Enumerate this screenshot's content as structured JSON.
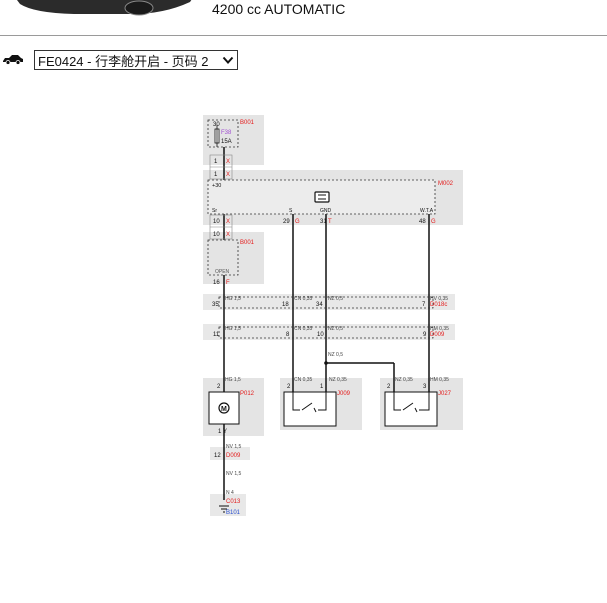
{
  "header": {
    "engine_label": "4200 cc AUTOMATIC",
    "car_icon": "car-side-icon"
  },
  "page_selector": {
    "value": "FE0424 - 行李舱开启 - 页码 2",
    "icon": "chevron-down-icon"
  },
  "diagram": {
    "fuse_box": {
      "ref": "B001",
      "pin_top": "30",
      "fuse": "F38",
      "rating": "15A",
      "pin_out": "1",
      "wire": "X"
    },
    "link_1": {
      "pin": "1",
      "wire": "X"
    },
    "module": {
      "ref": "M002",
      "label_30": "+30",
      "pin_sr": "Sr",
      "pin_s": "S",
      "pin_gnd": "GND",
      "pin_wt": "W.T.A"
    },
    "module_pins": [
      {
        "pin": "10",
        "wire": "X"
      },
      {
        "pin": "29",
        "wire": "G"
      },
      {
        "pin": "31",
        "wire": "T"
      },
      {
        "pin": "48",
        "wire": "G"
      }
    ],
    "link_2": {
      "pin": "10",
      "wire": "X"
    },
    "b001_box": {
      "ref": "B001",
      "label": "OPEN",
      "pin_out": "16",
      "wire": "F"
    },
    "connector_1": {
      "ref": "D018c",
      "pins": [
        {
          "pin": "35",
          "wire": "HG 1,5"
        },
        {
          "pin": "18",
          "wire": "CN 0,35"
        },
        {
          "pin": "34",
          "wire": "NZ 0,5"
        },
        {
          "pin": "7",
          "wire": "HV 0,35"
        }
      ]
    },
    "connector_2": {
      "ref": "D009",
      "pins": [
        {
          "pin": "11",
          "wire": "HG 1,5"
        },
        {
          "pin": "8",
          "wire": "CN 0,35"
        },
        {
          "pin": "10",
          "wire": "NZ 0,5"
        },
        {
          "pin": "9",
          "wire": "HM 0,35"
        }
      ]
    },
    "splice_wire": "NZ 0,5",
    "motor": {
      "ref": "P012",
      "pin_top": "2",
      "wire_top": "HG 1,5",
      "pin_bot": "1",
      "wire_bot": "Y"
    },
    "switch_j009": {
      "ref": "J009",
      "pin_a": "2",
      "wire_a": "CN 0,35",
      "pin_b": "1",
      "wire_b": "NZ 0,35"
    },
    "switch_j027": {
      "ref": "J027",
      "pin_a": "2",
      "wire_a": "NZ 0,35",
      "pin_b": "3",
      "wire_b": "HM 0,35"
    },
    "connector_3": {
      "wire_in": "NV 1,5",
      "pin": "12",
      "ref": "D009",
      "wire_out": "NV 1,5"
    },
    "ground": {
      "wire": "N 4",
      "ref": "C013",
      "point": "B101"
    }
  },
  "colors": {
    "ref_red": "#e31b1b",
    "fuse_purple": "#a04fd0",
    "ground_blue": "#2a4fd0",
    "panel_bg": "#e4e4e4"
  }
}
